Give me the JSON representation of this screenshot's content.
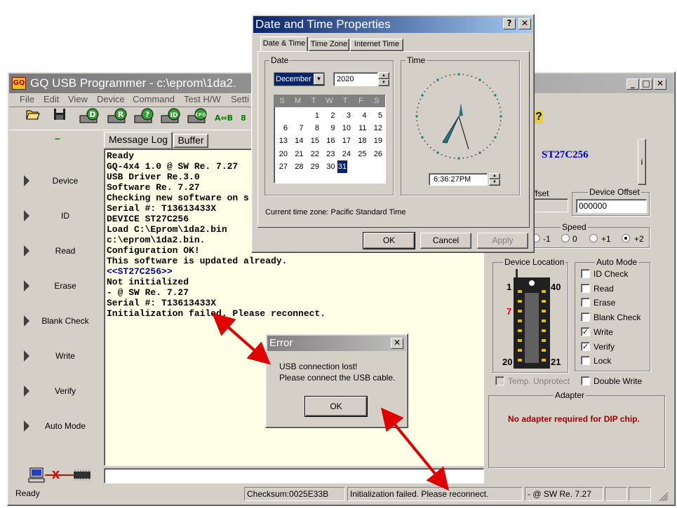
{
  "main_window": {
    "title": "GQ USB Programmer - c:\\eprom\\1da2.",
    "logo_text": "GQ",
    "menu": [
      "File",
      "Edit",
      "View",
      "Device",
      "Command",
      "Test H/W",
      "Setti"
    ],
    "toolbar": {
      "btn_device": "D",
      "btn_read": "R",
      "btn_verify": "?",
      "btn_id": "ID",
      "btn_cfg": "CFG",
      "btn_compare": "A⇔B",
      "btn_partial": "8",
      "btn_help": "?"
    },
    "sidebar": {
      "dash": "–",
      "items": [
        {
          "label": "Device"
        },
        {
          "label": "ID"
        },
        {
          "label": "Read"
        },
        {
          "label": "Erase"
        },
        {
          "label": "Blank Check"
        },
        {
          "label": "Write"
        },
        {
          "label": "Verify"
        },
        {
          "label": "Auto Mode"
        }
      ]
    },
    "tabs": {
      "message_log": "Message Log",
      "buffer": "Buffer"
    },
    "log_lines": [
      {
        "text": "Ready",
        "color": "#000000"
      },
      {
        "text": "GQ-4x4 1.0 @ SW Re. 7.27",
        "color": "#000000"
      },
      {
        "text": "USB Driver Re.3.0",
        "color": "#000000"
      },
      {
        "text": "Software Re. 7.27",
        "color": "#000000"
      },
      {
        "text": "Checking new software on s",
        "color": "#000000"
      },
      {
        "text": "Serial #: T13613433X",
        "color": "#000000"
      },
      {
        "text": "DEVICE ST27C256",
        "color": "#000000"
      },
      {
        "text": "Load C:\\Eprom\\1da2.bin",
        "color": "#000000"
      },
      {
        "text": "c:\\eprom\\1da2.bin.",
        "color": "#000000"
      },
      {
        "text": "Configuration OK!",
        "color": "#000000"
      },
      {
        "text": "This software is updated already.",
        "color": "#000000"
      },
      {
        "text": "<<ST27C256>>",
        "color": "#0000a0"
      },
      {
        "text": "Not initialized",
        "color": "#000000"
      },
      {
        "text": "- @ SW Re. 7.27",
        "color": "#000000"
      },
      {
        "text": "Serial #: T13613433X",
        "color": "#000000"
      },
      {
        "text": "Initialization failed. Please reconnect.",
        "color": "#000000"
      }
    ],
    "right_panel": {
      "device_name": "ST27C256",
      "side_btn": "i",
      "buffer_offset_label": "ffset",
      "device_offset_label": "Device Offset",
      "device_offset_value": "000000",
      "speed_label": "Speed",
      "speed_options": [
        "-1",
        "0",
        "+1",
        "+2"
      ],
      "speed_selected": "+2",
      "device_location_label": "Device Location",
      "pin_1": "1",
      "pin_40": "40",
      "pin_7": "7",
      "pin_20": "20",
      "pin_21": "21",
      "temp_unprotect": "Temp. Unprotect",
      "auto_mode_label": "Auto Mode",
      "auto_mode": [
        {
          "label": "ID Check",
          "checked": false
        },
        {
          "label": "Read",
          "checked": false
        },
        {
          "label": "Erase",
          "checked": false
        },
        {
          "label": "Blank Check",
          "checked": false
        },
        {
          "label": "Write",
          "checked": true
        },
        {
          "label": "Verify",
          "checked": true
        },
        {
          "label": "Lock",
          "checked": false
        }
      ],
      "double_write": "Double Write",
      "adapter_label": "Adapter",
      "adapter_text": "No adapter required for DIP chip."
    },
    "connection_x": "x",
    "statusbar": {
      "ready": "Ready",
      "checksum": "Checksum:0025E33B",
      "message": "Initialization failed. Please reconnect.",
      "version": "- @ SW Re. 7.27"
    }
  },
  "datetime_dialog": {
    "title": "Date and Time Properties",
    "help_btn": "?",
    "close_btn": "✕",
    "tabs": [
      "Date & Time",
      "Time Zone",
      "Internet Time"
    ],
    "date_group": "Date",
    "time_group": "Time",
    "month": "December",
    "year": "2020",
    "weekdays": [
      "S",
      "M",
      "T",
      "W",
      "T",
      "F",
      "S"
    ],
    "weeks": [
      [
        "",
        "",
        "1",
        "2",
        "3",
        "4",
        "5"
      ],
      [
        "6",
        "7",
        "8",
        "9",
        "10",
        "11",
        "12"
      ],
      [
        "13",
        "14",
        "15",
        "16",
        "17",
        "18",
        "19"
      ],
      [
        "20",
        "21",
        "22",
        "23",
        "24",
        "25",
        "26"
      ],
      [
        "27",
        "28",
        "29",
        "30",
        "31",
        "",
        ""
      ]
    ],
    "selected_day": "31",
    "time_value": "6:36:27PM",
    "timezone_text": "Current time zone:  Pacific Standard Time",
    "ok": "OK",
    "cancel": "Cancel",
    "apply": "Apply"
  },
  "error_dialog": {
    "title": "Error",
    "close_btn": "✕",
    "message_line1": "USB connection lost!",
    "message_line2": "Please connect the USB cable.",
    "ok": "OK"
  },
  "colors": {
    "title_active": "#0a246a",
    "title_inactive": "#808080",
    "face": "#d4d0c8",
    "log_bg": "#ffffe8",
    "arrow_red": "#e00000",
    "device_blue": "#0000c0",
    "adapter_red": "#a00000"
  }
}
